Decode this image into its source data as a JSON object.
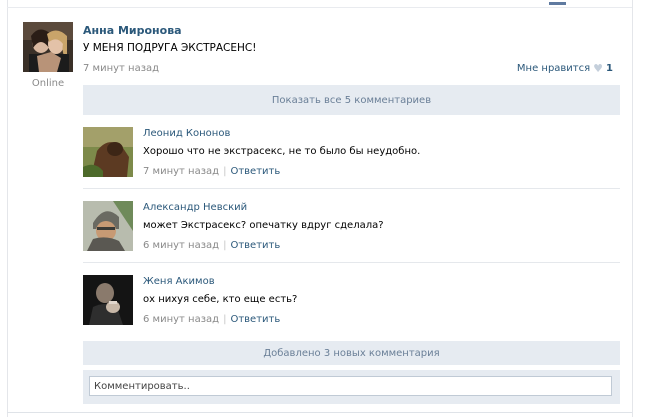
{
  "post": {
    "author": "Анна Миронова",
    "status": "Online",
    "text": "У МЕНЯ ПОДРУГА ЭКСТРАСЕНС!",
    "time": "7 минут назад",
    "like_label": "Мне нравится",
    "like_count": "1"
  },
  "show_all_comments": "Показать все 5 комментариев",
  "comments": [
    {
      "author": "Леонид Кононов",
      "text": "Хорошо что не экстрасекс, не то было бы неудобно.",
      "time": "7 минут назад",
      "reply": "Ответить"
    },
    {
      "author": "Александр Невский",
      "text": "может Экстрасекс? опечатку вдруг сделала?",
      "time": "6 минут назад",
      "reply": "Ответить"
    },
    {
      "author": "Женя Акимов",
      "text": "ох нихуя себе, кто еще есть?",
      "time": "6 минут назад",
      "reply": "Ответить"
    }
  ],
  "added_comments": "Добавлено 3 новых комментария",
  "composer": {
    "placeholder": "Комментировать.."
  },
  "colors": {
    "link": "#2b587a",
    "bar_bg": "#e6ebf1",
    "meta": "#8a8a8a"
  }
}
